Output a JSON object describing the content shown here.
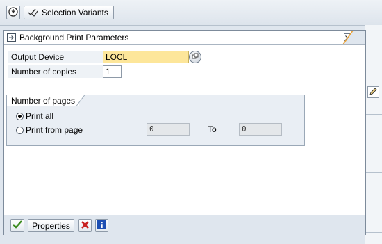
{
  "toolbar": {
    "selection_variants_label": "Selection Variants"
  },
  "dialog": {
    "title": "Background Print Parameters",
    "output_device": {
      "label": "Output Device",
      "value": "LOCL"
    },
    "copies": {
      "label": "Number of copies",
      "value": "1"
    },
    "pages_group": {
      "title": "Number of pages",
      "print_all_label": "Print all",
      "print_from_label": "Print from page",
      "from_value": "0",
      "to_label": "To",
      "to_value": "0",
      "selected": "Print all"
    },
    "footer": {
      "properties_label": "Properties"
    }
  },
  "colors": {
    "required_field": "#fde69a",
    "title_accent": "#e8a33c",
    "confirm_green": "#3a8a1e",
    "cancel_red": "#c8201f",
    "info_blue": "#1d4fb3"
  },
  "icons": [
    "execute-icon",
    "variants-icon",
    "dialog-title-icon",
    "close-icon",
    "f4-help-icon",
    "pen-icon",
    "checkmark-icon",
    "cancel-x-icon",
    "info-icon"
  ]
}
